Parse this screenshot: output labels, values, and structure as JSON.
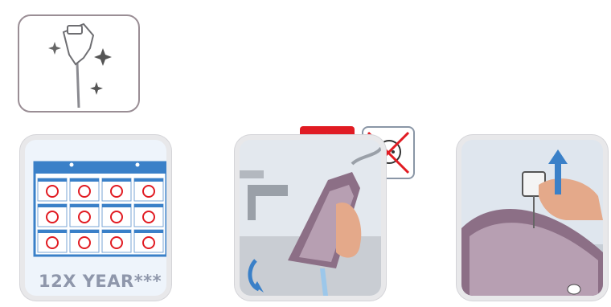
{
  "top_icon": {
    "name": "anti-calc-valve-sparkle-icon"
  },
  "tiles": [
    {
      "id": "calendar",
      "icon": "calendar-grid-icon",
      "caption": "12X YEAR***"
    },
    {
      "id": "unplug",
      "icon": "iron-tilt-illustration",
      "warning_icon": "warning-triangle-icon",
      "unplug_icon": "unplug-socket-icon"
    },
    {
      "id": "remove",
      "icon": "pull-out-valve-illustration"
    }
  ],
  "colors": {
    "accent_red": "#e11b22",
    "caption_gray": "#8f97ab",
    "iron_purple": "#8c6f86"
  }
}
